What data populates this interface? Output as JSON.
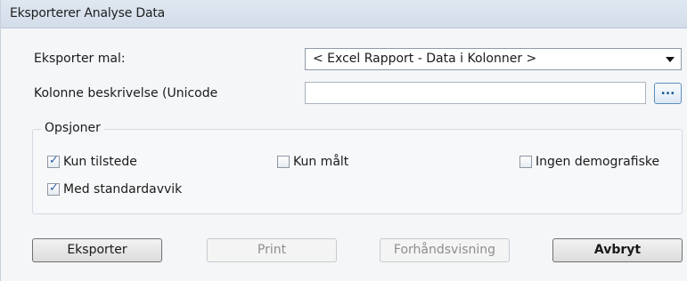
{
  "window": {
    "title": "Eksporterer Analyse Data"
  },
  "form": {
    "template_label": "Eksporter mal:",
    "template_value": "< Excel Rapport - Data i Kolonner >",
    "column_desc_label": "Kolonne beskrivelse (Unicode",
    "column_desc_value": "",
    "browse_label": "..."
  },
  "options": {
    "legend": "Opsjoner",
    "checkboxes": [
      {
        "label": "Kun tilstede",
        "checked": true
      },
      {
        "label": "Kun målt",
        "checked": false
      },
      {
        "label": "Ingen demografiske",
        "checked": false
      },
      {
        "label": "Med standardavvik",
        "checked": true
      }
    ]
  },
  "buttons": {
    "export": "Eksporter",
    "print": "Print",
    "preview": "Forhåndsvisning",
    "cancel": "Avbryt"
  }
}
